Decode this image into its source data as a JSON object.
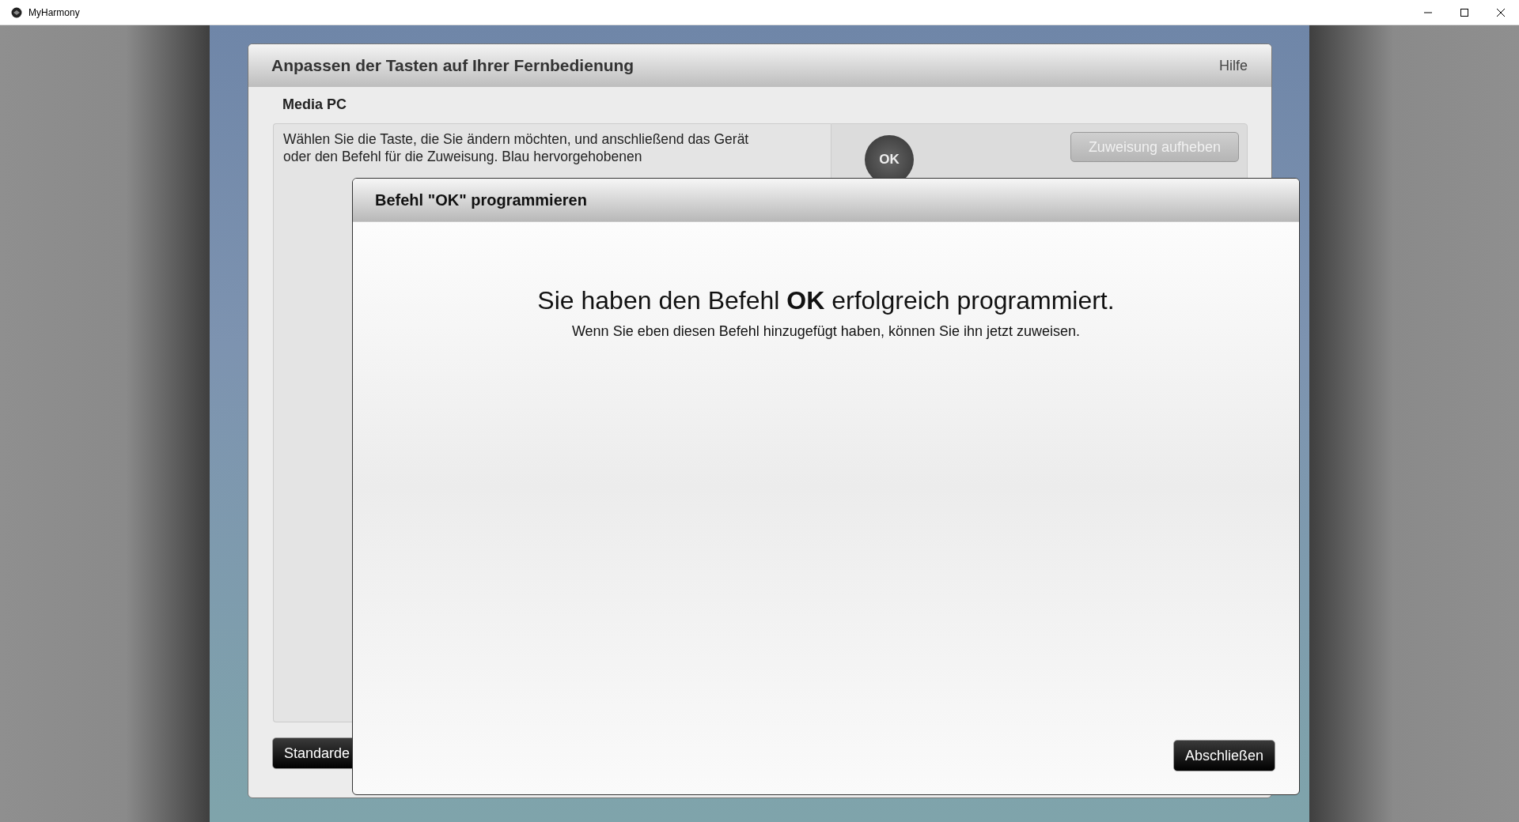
{
  "window": {
    "title": "MyHarmony"
  },
  "panel": {
    "title": "Anpassen der Tasten auf Ihrer Fernbedienung",
    "help": "Hilfe",
    "device": "Media PC",
    "instructions": "Wählen Sie die Taste, die Sie ändern möchten, und anschließend das Gerät oder den Befehl für die Zuweisung. Blau hervorgehobenen",
    "key_label": "OK",
    "unassign_button": {
      "label": "Zuweisung aufheben",
      "disabled": true
    },
    "default_button": "Standarde"
  },
  "dialog": {
    "title": "Befehl \"OK\" programmieren",
    "headline": "Sie haben den Befehl **OK** erfolgreich programmiert.",
    "message": "Wenn Sie eben diesen Befehl hinzugefügt haben, können Sie ihn jetzt zuweisen.",
    "finish_button": "Abschließen"
  }
}
